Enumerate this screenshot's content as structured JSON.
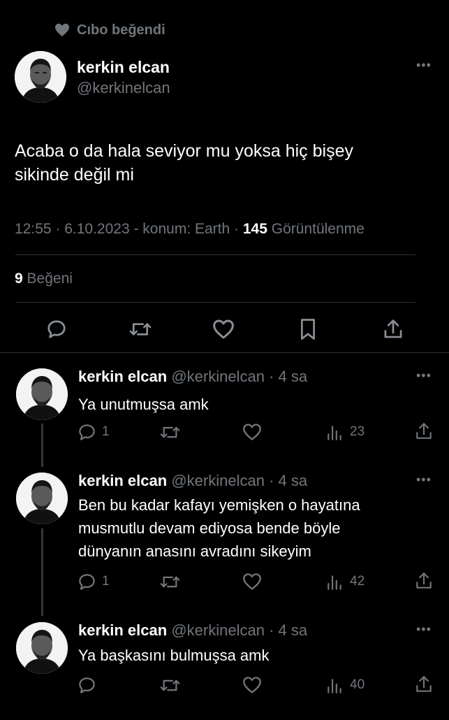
{
  "social_context": {
    "text": "Cıbo beğendi"
  },
  "main": {
    "name": "kerkin elcan",
    "handle": "@kerkinelcan",
    "text_line1": "Acaba o da hala seviyor mu yoksa hiç bişey",
    "text_line2": "sikinde değil mi",
    "meta_prefix": "12:55 · 6.10.2023 - konum: Earth · ",
    "views_count": "145",
    "views_label": " Görüntülenme",
    "likes_count": "9",
    "likes_label": " Beğeni"
  },
  "replies": [
    {
      "name": "kerkin elcan",
      "handle": "@kerkinelcan",
      "time": "· 4 sa",
      "lines": [
        "Ya unutmuşsa amk"
      ],
      "reply_count": "1",
      "views": "23"
    },
    {
      "name": "kerkin elcan",
      "handle": "@kerkinelcan",
      "time": "· 4 sa",
      "lines": [
        "Ben bu kadar kafayı yemişken o hayatına",
        "musmutlu devam ediyosa bende böyle",
        "dünyanın anasını avradını sikeyim"
      ],
      "reply_count": "1",
      "views": "42"
    },
    {
      "name": "kerkin elcan",
      "handle": "@kerkinelcan",
      "time": "· 4 sa",
      "lines": [
        "Ya başkasını bulmuşsa amk"
      ],
      "reply_count": "",
      "views": "40"
    }
  ],
  "icons": {
    "heart": "heart-icon",
    "comment": "comment-icon",
    "retweet": "retweet-icon",
    "bookmark": "bookmark-icon",
    "share": "share-icon",
    "views": "views-icon",
    "more": "more-icon"
  }
}
